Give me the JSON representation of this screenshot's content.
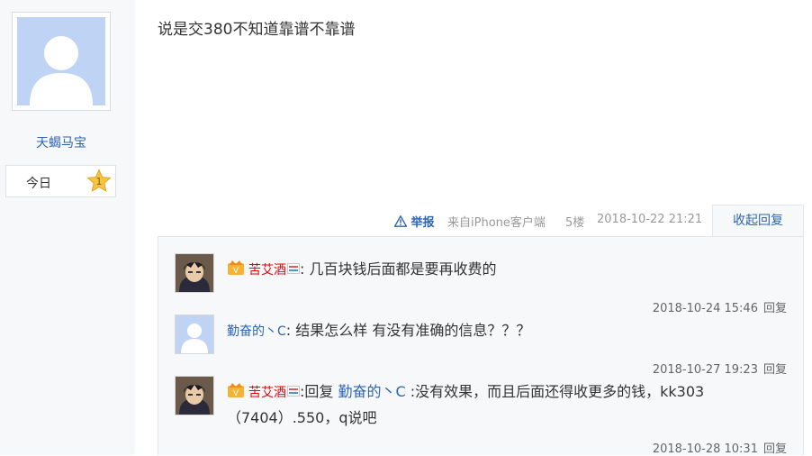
{
  "author": {
    "name": "天蝎马宝",
    "today_label": "今日",
    "level": "1"
  },
  "post": {
    "content": "说是交380不知道靠谱不靠谱",
    "report_label": "举报",
    "client": "来自iPhone客户端",
    "floor": "5楼",
    "time": "2018-10-22 21:21",
    "fold_label": "收起回复"
  },
  "replies": [
    {
      "name": "苦艾酒",
      "sep": ":",
      "text": " 几百块钱后面都是要再收费的",
      "time": "2018-10-24 15:46",
      "reply_label": "回复"
    },
    {
      "name": "勤奋的丶C",
      "sep": ":",
      "text": " 结果怎么样 有没有准确的信息？？？",
      "time": "2018-10-27 19:23",
      "reply_label": "回复"
    },
    {
      "name": "苦艾酒",
      "sep": ":",
      "prefix": "回复 ",
      "mention": "勤奋的丶C",
      "text": " :没有效果，而且后面还得收更多的钱，kk303（7404）.550，q说吧",
      "time": "2018-10-28 10:31",
      "reply_label": "回复"
    }
  ],
  "colors": {
    "link": "#2d64b3",
    "vip_name": "#e10602",
    "panel_bg": "#f7f8fa",
    "avatar_bg": "#bfd4f5"
  }
}
